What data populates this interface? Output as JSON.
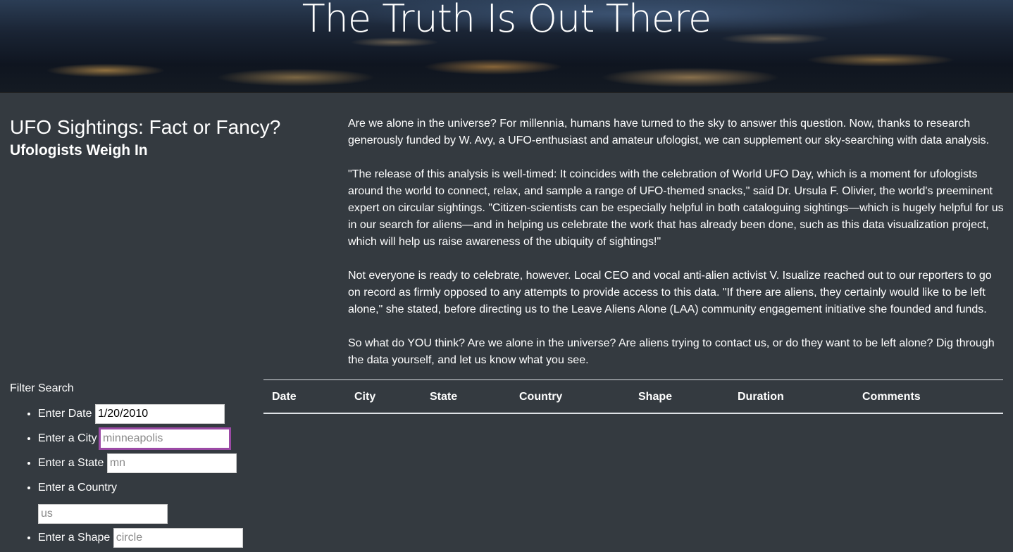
{
  "hero": {
    "title": "The Truth Is Out There"
  },
  "header": {
    "title": "UFO Sightings: Fact or Fancy?",
    "subtitle": "Ufologists Weigh In"
  },
  "article": {
    "paragraphs": [
      "Are we alone in the universe? For millennia, humans have turned to the sky to answer this question. Now, thanks to research generously funded by W. Avy, a UFO-enthusiast and amateur ufologist, we can supplement our sky-searching with data analysis.",
      "\"The release of this analysis is well-timed: It coincides with the celebration of World UFO Day, which is a moment for ufologists around the world to connect, relax, and sample a range of UFO-themed snacks,\" said Dr. Ursula F. Olivier, the world's preeminent expert on circular sightings. \"Citizen-scientists can be especially helpful in both cataloguing sightings—which is hugely helpful for us in our search for aliens—and in helping us celebrate the work that has already been done, such as this data visualization project, which will help us raise awareness of the ubiquity of sightings!\"",
      "Not everyone is ready to celebrate, however. Local CEO and vocal anti-alien activist V. Isualize reached out to our reporters to go on record as firmly opposed to any attempts to provide access to this data. \"If there are aliens, they certainly would like to be left alone,\" she stated, before directing us to the Leave Aliens Alone (LAA) community engagement initiative she founded and funds.",
      "So what do YOU think? Are we alone in the universe? Are aliens trying to contact us, or do they want to be left alone? Dig through the data yourself, and let us know what you see."
    ]
  },
  "filter": {
    "title": "Filter Search",
    "fields": [
      {
        "label": "Enter Date",
        "value": "1/20/2010",
        "placeholder": ""
      },
      {
        "label": "Enter a City",
        "value": "",
        "placeholder": "minneapolis"
      },
      {
        "label": "Enter a State",
        "value": "",
        "placeholder": "mn"
      },
      {
        "label": "Enter a Country",
        "value": "",
        "placeholder": "us"
      },
      {
        "label": "Enter a Shape",
        "value": "",
        "placeholder": "circle"
      }
    ]
  },
  "table": {
    "columns": [
      "Date",
      "City",
      "State",
      "Country",
      "Shape",
      "Duration",
      "Comments"
    ]
  }
}
